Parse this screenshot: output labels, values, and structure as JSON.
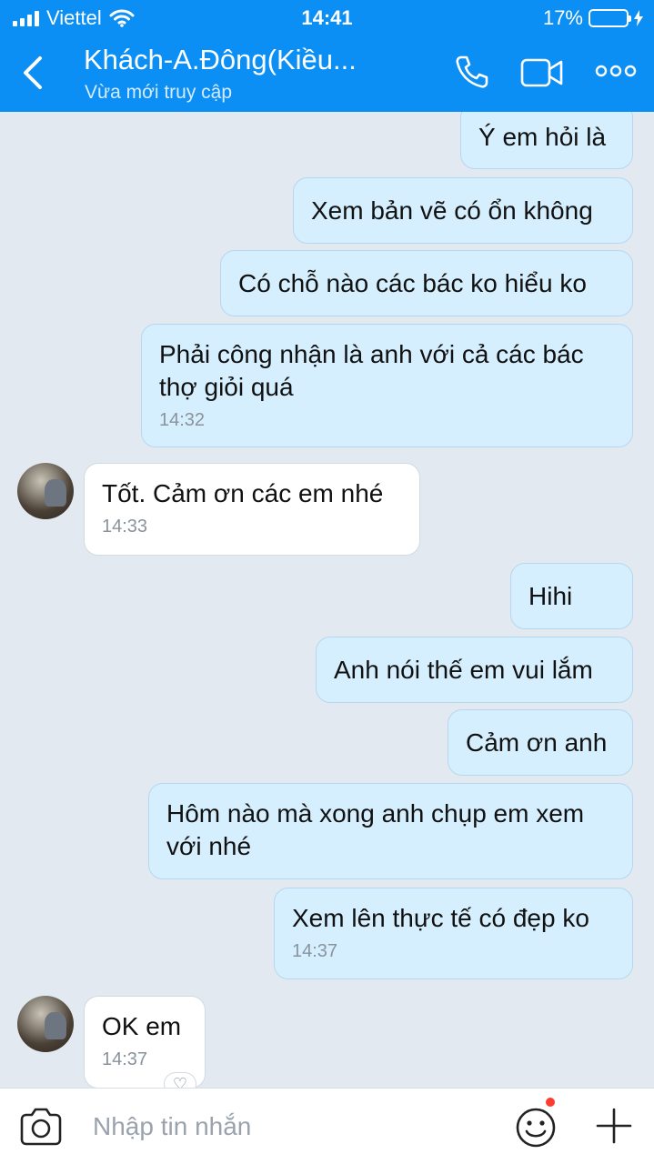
{
  "status_bar": {
    "carrier": "Viettel",
    "time": "14:41",
    "battery": "17%"
  },
  "header": {
    "title": "Khách-A.Đông(Kiều...",
    "subtitle": "Vừa mới truy cập"
  },
  "messages": [
    {
      "text": "Ý em hỏi là"
    },
    {
      "text": "Xem bản vẽ có ổn không"
    },
    {
      "text": "Có chỗ nào các bác ko hiểu ko"
    },
    {
      "line1": "Phải công nhận là anh với cả các bác",
      "line2": "thợ giỏi quá",
      "time": "14:32"
    },
    {
      "text": "Tốt. Cảm ơn các em nhé",
      "time": "14:33"
    },
    {
      "text": "Hihi"
    },
    {
      "text": "Anh nói thế em vui lắm"
    },
    {
      "text": "Cảm ơn anh"
    },
    {
      "line1": "Hôm nào mà xong anh chụp em xem",
      "line2": "với nhé"
    },
    {
      "text": "Xem lên thực tế có đẹp ko",
      "time": "14:37"
    },
    {
      "text": "OK em",
      "time": "14:37"
    }
  ],
  "composer": {
    "placeholder": "Nhập tin nhắn"
  },
  "colors": {
    "header_bg": "#0b8ff4",
    "outgoing_bubble": "#d5efff",
    "incoming_bubble": "#ffffff",
    "chat_bg": "#e2e9f1"
  }
}
